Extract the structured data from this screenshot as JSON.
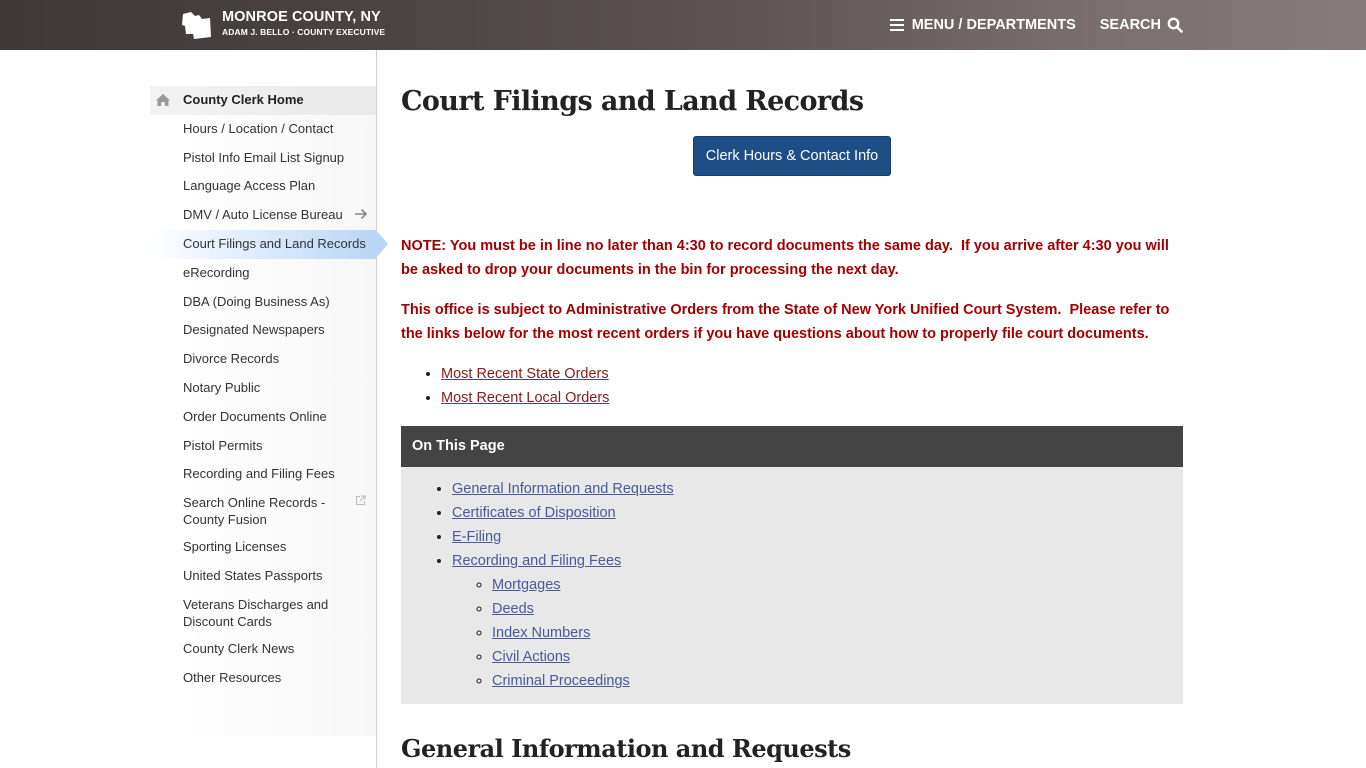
{
  "header": {
    "title": "MONROE COUNTY, NY",
    "subtitle": "ADAM J. BELLO · COUNTY EXECUTIVE",
    "menu_label": "MENU / DEPARTMENTS",
    "search_label": "SEARCH",
    "icons": {
      "menu": "hamburger-icon",
      "search": "search-icon",
      "logo": "county-map-logo"
    }
  },
  "sidebar": {
    "items": [
      {
        "label": "County Clerk Home",
        "icon": "home-icon"
      },
      {
        "label": "Hours / Location / Contact"
      },
      {
        "label": "Pistol Info Email List Signup"
      },
      {
        "label": "Language Access Plan"
      },
      {
        "label": "DMV / Auto License Bureau",
        "icon": "arrow-right-icon"
      },
      {
        "label": "Court Filings and Land Records",
        "active": true
      },
      {
        "label": "eRecording"
      },
      {
        "label": "DBA (Doing Business As)"
      },
      {
        "label": "Designated Newspapers"
      },
      {
        "label": "Divorce Records"
      },
      {
        "label": "Notary Public"
      },
      {
        "label": "Order Documents Online"
      },
      {
        "label": "Pistol Permits"
      },
      {
        "label": "Recording and Filing Fees"
      },
      {
        "label": "Search Online Records - County Fusion",
        "icon": "external-link-icon"
      },
      {
        "label": "Sporting Licenses"
      },
      {
        "label": "United States Passports"
      },
      {
        "label": "Veterans Discharges and Discount Cards"
      },
      {
        "label": "County Clerk News"
      },
      {
        "label": "Other Resources"
      }
    ]
  },
  "main": {
    "title": "Court Filings and Land Records",
    "contact_button": "Clerk Hours & Contact Info",
    "note1": "NOTE: You must be in line no later than 4:30 to record documents the same day.  If you arrive after 4:30 you will be asked to drop your documents in the bin for processing the next day.",
    "note2": "This office is subject to Administrative Orders from the State of New York Unified Court System.  Please refer to the links below for the most recent orders if you have questions about how to properly file court documents.",
    "order_links": [
      "Most Recent State Orders",
      "Most Recent Local Orders"
    ],
    "on_this_page": {
      "heading": "On This Page",
      "links": [
        "General Information and Requests",
        "Certificates of Disposition",
        "E-Filing",
        "Recording and Filing Fees"
      ],
      "sub_links": [
        "Mortgages",
        "Deeds",
        "Index Numbers",
        "Civil Actions",
        "Criminal Proceedings"
      ]
    },
    "section_title": "General Information and Requests"
  },
  "colors": {
    "header_dark": "#3f3838",
    "header_light": "#877b7b",
    "button_blue": "#1d4e86",
    "note_red": "#a50000",
    "link_red": "#8b1a1a",
    "link_blue": "#4a5a9c",
    "otp_header": "#444444",
    "otp_bg": "#e8e8e8",
    "active_nav": "#b8d6f8"
  }
}
